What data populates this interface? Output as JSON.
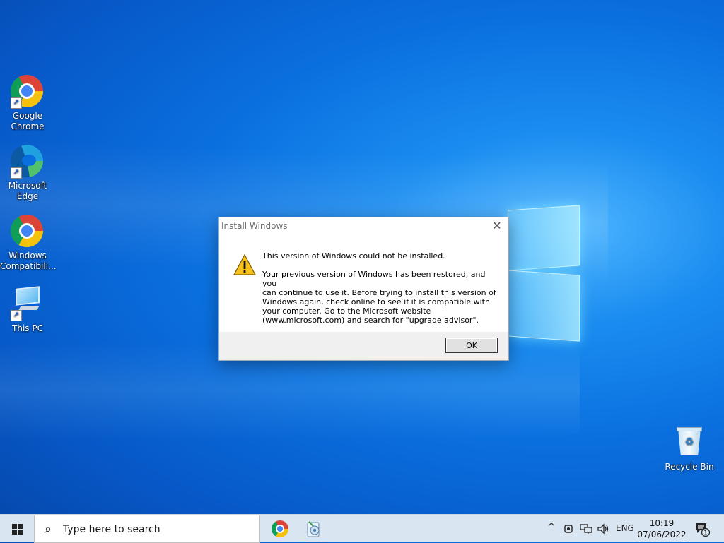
{
  "desktop": {
    "icons": [
      {
        "label": "Google Chrome",
        "icon": "chrome-icon"
      },
      {
        "label": "Microsoft Edge",
        "icon": "edge-icon"
      },
      {
        "label": "Windows Compatibili...",
        "icon": "chrome-icon"
      },
      {
        "label": "This PC",
        "icon": "this-pc-icon"
      },
      {
        "label": "Recycle Bin",
        "icon": "recycle-bin-icon"
      }
    ]
  },
  "dialog": {
    "title": "Install Windows",
    "close_glyph": "✕",
    "icon": "warning-icon",
    "heading": "This version of Windows could not be installed.",
    "body": "Your previous version of Windows has been restored, and you\ncan continue to use it.  Before trying to install this version of\nWindows again, check online to see if it is compatible with\nyour computer.  Go to the Microsoft website\n(www.microsoft.com) and search for \"upgrade advisor\".",
    "ok_label": "OK"
  },
  "taskbar": {
    "search_placeholder": "Type here to search",
    "apps": [
      {
        "name": "Google Chrome",
        "icon": "chrome-icon",
        "active": false
      },
      {
        "name": "Windows Setup",
        "icon": "setup-icon",
        "active": true
      }
    ],
    "tray": {
      "chevron": "^",
      "language": "ENG",
      "time": "10:19",
      "date": "07/06/2022",
      "notification_count": "1"
    }
  },
  "colors": {
    "accent": "#0a64c8",
    "taskbar": "#d9e5f1",
    "dialog_footer": "#f0f0f0"
  }
}
